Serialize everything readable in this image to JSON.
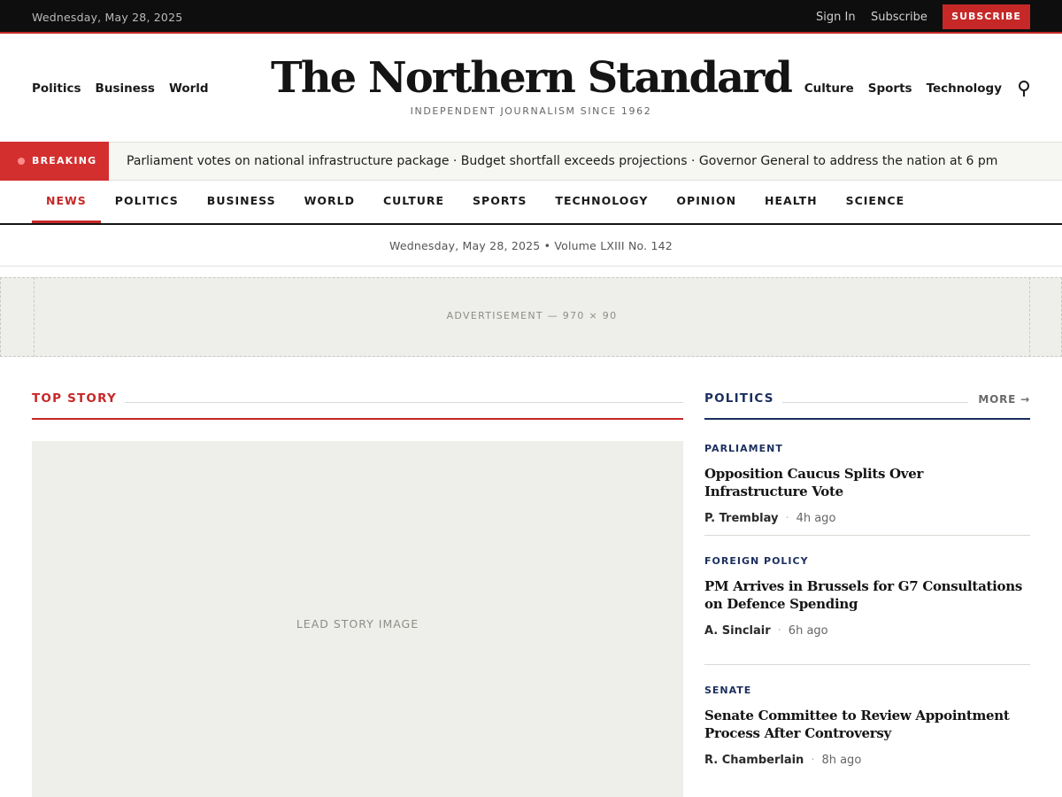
{
  "topbar": {
    "date": "Wednesday, May 28, 2025",
    "sign_in": "Sign In",
    "subscribe": "Subscribe",
    "subscribe_button": "SUBSCRIBE",
    "accent_color": "#c62828"
  },
  "masthead": {
    "left_nav": [
      "Politics",
      "Business",
      "World"
    ],
    "right_nav": [
      "Culture",
      "Sports",
      "Technology"
    ],
    "logo": "The Northern Standard",
    "tagline": "INDEPENDENT JOURNALISM SINCE 1962",
    "search_icon": "search-icon"
  },
  "breaking": {
    "label": "BREAKING",
    "ticker": "Parliament votes on national infrastructure package · Budget shortfall exceeds projections · Governor General to address the nation at 6 pm"
  },
  "section_nav": {
    "items": [
      "NEWS",
      "POLITICS",
      "BUSINESS",
      "WORLD",
      "CULTURE",
      "SPORTS",
      "TECHNOLOGY",
      "OPINION",
      "HEALTH",
      "SCIENCE"
    ],
    "active": "NEWS"
  },
  "dateline": "Wednesday, May 28, 2025 • Volume LXIII No. 142",
  "ad": {
    "label": "ADVERTISEMENT — 970 × 90"
  },
  "top_story": {
    "label": "TOP STORY",
    "image_placeholder": "LEAD STORY IMAGE"
  },
  "politics": {
    "label": "POLITICS",
    "more": "MORE →",
    "accent_color": "#1b2f5e",
    "articles": [
      {
        "kicker": "PARLIAMENT",
        "headline": "Opposition Caucus Splits Over Infrastructure Vote",
        "author": "P. Tremblay",
        "time": "4h ago"
      },
      {
        "kicker": "FOREIGN POLICY",
        "headline": "PM Arrives in Brussels for G7 Consultations on Defence Spending",
        "author": "A. Sinclair",
        "time": "6h ago"
      },
      {
        "kicker": "SENATE",
        "headline": "Senate Committee to Review Appointment Process After Controversy",
        "author": "R. Chamberlain",
        "time": "8h ago"
      }
    ]
  }
}
